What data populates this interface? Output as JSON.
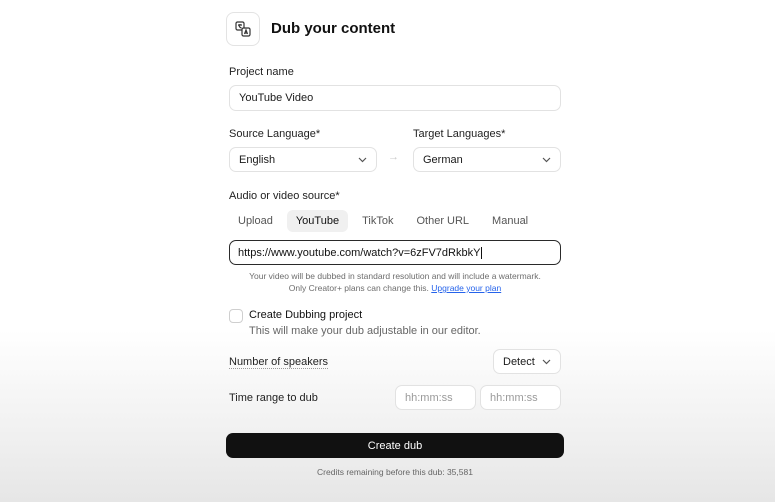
{
  "header": {
    "title": "Dub your content",
    "icon": "translate-icon"
  },
  "project": {
    "label": "Project name",
    "value": "YouTube Video"
  },
  "source_language": {
    "label": "Source Language*",
    "value": "English"
  },
  "target_languages": {
    "label": "Target Languages*",
    "value": "German"
  },
  "source": {
    "label": "Audio or video source*",
    "tabs": [
      "Upload",
      "YouTube",
      "TikTok",
      "Other URL",
      "Manual"
    ],
    "active_tab": "YouTube",
    "url_value": "https://www.youtube.com/watch?v=6zFV7dRkbkY",
    "notice_line1": "Your video will be dubbed in standard resolution and will include a watermark.",
    "notice_line2": "Only Creator+ plans can change this.",
    "upgrade_link": "Upgrade your plan"
  },
  "dubbing_project": {
    "checked": false,
    "title": "Create Dubbing project",
    "subtitle": "This will make your dub adjustable in our editor."
  },
  "speakers": {
    "label": "Number of speakers",
    "value": "Detect"
  },
  "time_range": {
    "label": "Time range to dub",
    "start_placeholder": "hh:mm:ss",
    "end_placeholder": "hh:mm:ss"
  },
  "actions": {
    "create_label": "Create dub"
  },
  "credits": {
    "text": "Credits remaining before this dub: 35,581"
  },
  "colors": {
    "primary_button": "#111111",
    "link": "#2563eb"
  }
}
